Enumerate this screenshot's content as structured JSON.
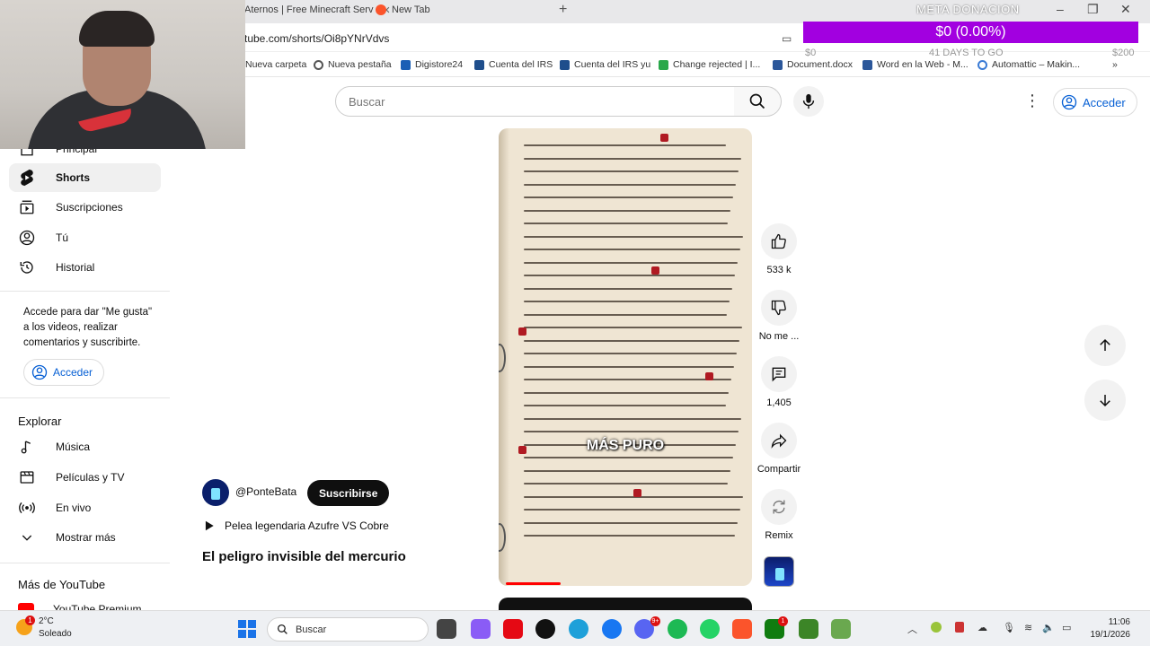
{
  "browser": {
    "tabs": [
      {
        "title": "Aternos | Free Minecraft Serv"
      },
      {
        "title": "New Tab"
      }
    ],
    "url": "tube.com/shorts/Oi8pYNrVdvs",
    "bookmarks": [
      {
        "label": "Nueva carpeta",
        "icon": "folder-icon",
        "color": "#e0b13a"
      },
      {
        "label": "Nueva pestaña",
        "icon": "globe-icon",
        "color": "#555555"
      },
      {
        "label": "Digistore24",
        "icon": "digistore-icon",
        "color": "#1b5fb5"
      },
      {
        "label": "Cuenta del IRS",
        "icon": "irs-icon",
        "color": "#1f4e8c"
      },
      {
        "label": "Cuenta del IRS yu",
        "icon": "irs-icon",
        "color": "#1f4e8c"
      },
      {
        "label": "Change rejected | I...",
        "icon": "change-icon",
        "color": "#2aa84a"
      },
      {
        "label": "Document.docx",
        "icon": "word-icon",
        "color": "#2b579a"
      },
      {
        "label": "Word en la Web - M...",
        "icon": "word-icon",
        "color": "#2b579a"
      },
      {
        "label": "Automattic – Makin...",
        "icon": "automattic-icon",
        "color": "#3a7bd5"
      }
    ]
  },
  "donation": {
    "title": "META DONACION",
    "amount": "$0 (0.00%)",
    "min": "$0",
    "days": "41 DAYS TO GO",
    "max": "$200",
    "bar_color": "#a200e0"
  },
  "search": {
    "placeholder": "Buscar"
  },
  "header": {
    "signin": "Acceder"
  },
  "sidebar": {
    "items": [
      {
        "label": "Principal",
        "icon": "home-icon"
      },
      {
        "label": "Shorts",
        "icon": "shorts-icon"
      },
      {
        "label": "Suscripciones",
        "icon": "subscriptions-icon"
      },
      {
        "label": "Tú",
        "icon": "user-icon"
      },
      {
        "label": "Historial",
        "icon": "history-icon"
      }
    ],
    "prompt": "Accede para dar \"Me gusta\" a los videos, realizar comentarios y suscribirte.",
    "signin": "Acceder",
    "explore_heading": "Explorar",
    "explore": [
      {
        "label": "Música",
        "icon": "music-icon"
      },
      {
        "label": "Películas y TV",
        "icon": "film-icon"
      },
      {
        "label": "En vivo",
        "icon": "live-icon"
      },
      {
        "label": "Mostrar más",
        "icon": "chevron-down-icon"
      }
    ],
    "more_heading": "Más de YouTube",
    "more_first": "YouTube Premium"
  },
  "short": {
    "caption": "MÁS PURO",
    "progress": 0.23,
    "channel": "@PonteBata",
    "subscribe": "Suscribirse",
    "playlist": "Pelea legendaria Azufre VS Cobre",
    "title": "El peligro invisible del mercurio"
  },
  "actions": {
    "like": "533 k",
    "dislike": "No me ...",
    "comments": "1,405",
    "share": "Compartir",
    "remix": "Remix"
  },
  "taskbar": {
    "weather_temp": "2°C",
    "weather_cond": "Soleado",
    "weather_badge": "1",
    "search": "Buscar",
    "time": "11:06",
    "date": "19/1/2026",
    "apps": [
      {
        "name": "file-explorer-icon",
        "color": "#444444"
      },
      {
        "name": "copilot-icon",
        "color": "#8a5cf6"
      },
      {
        "name": "netflix-icon",
        "color": "#e50914"
      },
      {
        "name": "tiktok-icon",
        "color": "#111111"
      },
      {
        "name": "edge-icon",
        "color": "#1ea0d9"
      },
      {
        "name": "messenger-icon",
        "color": "#1877f2"
      },
      {
        "name": "discord-icon",
        "color": "#5865f2"
      },
      {
        "name": "spotify-icon",
        "color": "#1db954"
      },
      {
        "name": "whatsapp-icon",
        "color": "#25d366"
      },
      {
        "name": "brave-icon",
        "color": "#fb542b"
      },
      {
        "name": "xbox-icon",
        "color": "#107c10"
      },
      {
        "name": "minecraft-icon",
        "color": "#3c8527"
      },
      {
        "name": "minecraft-launcher-icon",
        "color": "#6aa84f"
      }
    ],
    "badges": {
      "discord": "9+",
      "xbox": "1"
    }
  }
}
